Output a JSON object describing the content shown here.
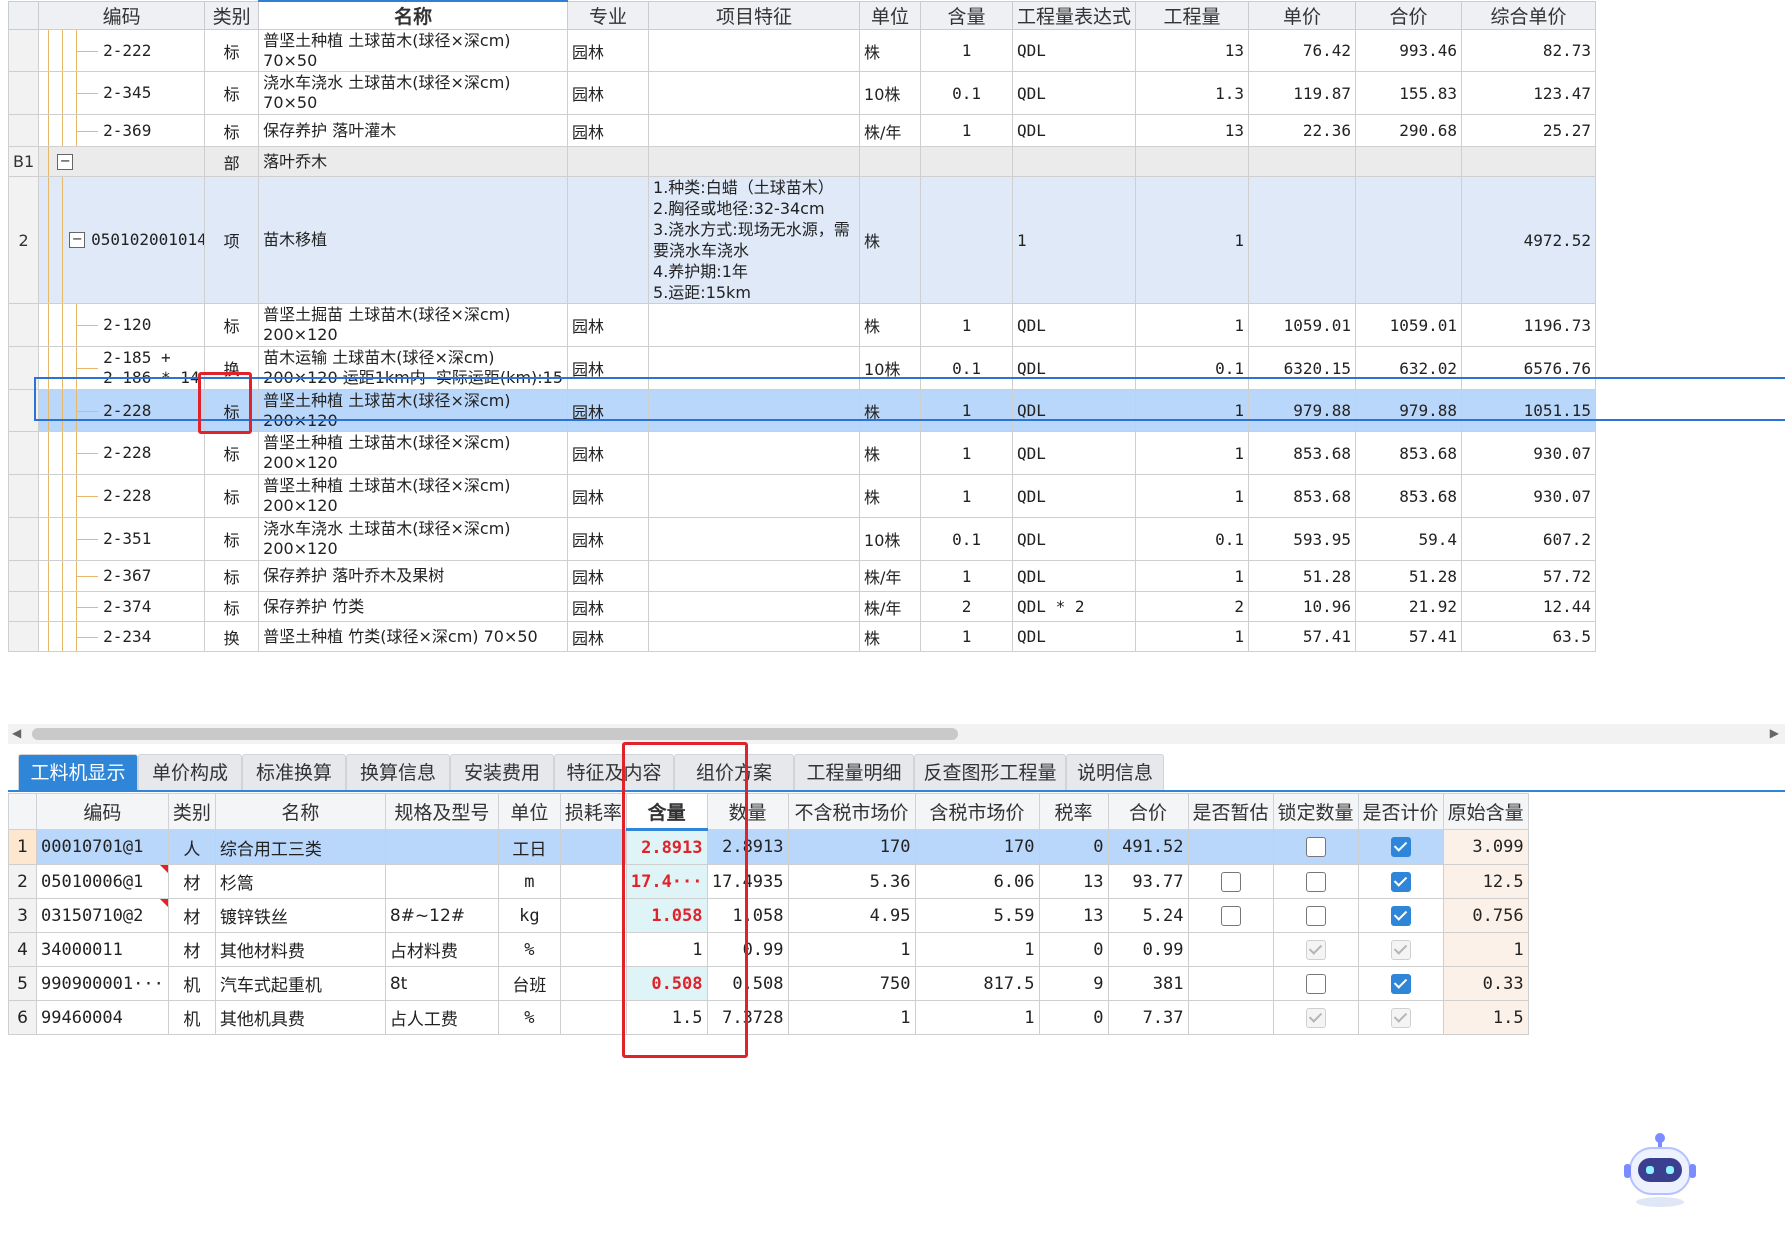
{
  "top_grid": {
    "headers": [
      "编码",
      "类别",
      "名称",
      "专业",
      "项目特征",
      "单位",
      "含量",
      "工程量表达式",
      "工程量",
      "单价",
      "合价",
      "综合单价"
    ],
    "rows": [
      {
        "rownum": "",
        "code": "2-222",
        "cat": "标",
        "name": "普坚土种植 土球苗木(球径×深cm)\n70×50",
        "major": "园林",
        "feature": "",
        "unit": "株",
        "content": "1",
        "expr": "QDL",
        "qty": "13",
        "price": "76.42",
        "total": "993.46",
        "comp": "82.73"
      },
      {
        "rownum": "",
        "code": "2-345",
        "cat": "标",
        "name": "浇水车浇水 土球苗木(球径×深cm)\n70×50",
        "major": "园林",
        "feature": "",
        "unit": "10株",
        "content": "0.1",
        "expr": "QDL",
        "qty": "1.3",
        "price": "119.87",
        "total": "155.83",
        "comp": "123.47"
      },
      {
        "rownum": "",
        "code": "2-369",
        "cat": "标",
        "name": "保存养护 落叶灌木",
        "major": "园林",
        "feature": "",
        "unit": "株/年",
        "content": "1",
        "expr": "QDL",
        "qty": "13",
        "price": "22.36",
        "total": "290.68",
        "comp": "25.27"
      },
      {
        "rownum": "B1",
        "code": "",
        "cat": "部",
        "name": "落叶乔木",
        "major": "",
        "feature": "",
        "unit": "",
        "content": "",
        "expr": "",
        "qty": "",
        "price": "",
        "total": "",
        "comp": ""
      },
      {
        "rownum": "2",
        "code": "050102001014",
        "cat": "项",
        "name": "苗木移植",
        "major": "",
        "feature": "1.种类:白蜡（土球苗木）\n2.胸径或地径:32-34cm\n3.浇水方式:现场无水源，需\n要浇水车浇水\n4.养护期:1年\n5.运距:15km",
        "unit": "株",
        "content": "",
        "expr": "1",
        "qty": "1",
        "price": "",
        "total": "",
        "comp": "4972.52"
      },
      {
        "rownum": "",
        "code": "2-120",
        "cat": "标",
        "name": "普坚土掘苗 土球苗木(球径×深cm)\n200×120",
        "major": "园林",
        "feature": "",
        "unit": "株",
        "content": "1",
        "expr": "QDL",
        "qty": "1",
        "price": "1059.01",
        "total": "1059.01",
        "comp": "1196.73"
      },
      {
        "rownum": "",
        "code": "2-185 +\n2-186 * 14",
        "cat": "换",
        "name": "苗木运输 土球苗木(球径×深cm)\n200×120 运距1km内  实际运距(km):15",
        "major": "园林",
        "feature": "",
        "unit": "10株",
        "content": "0.1",
        "expr": "QDL",
        "qty": "0.1",
        "price": "6320.15",
        "total": "632.02",
        "comp": "6576.76"
      },
      {
        "rownum": "",
        "code": "2-228",
        "cat": "标",
        "name": "普坚土种植 土球苗木(球径×深cm)\n200×120",
        "major": "园林",
        "feature": "",
        "unit": "株",
        "content": "1",
        "expr": "QDL",
        "qty": "1",
        "price": "979.88",
        "total": "979.88",
        "comp": "1051.15"
      },
      {
        "rownum": "",
        "code": "2-228",
        "cat": "标",
        "name": "普坚土种植 土球苗木(球径×深cm)\n200×120",
        "major": "园林",
        "feature": "",
        "unit": "株",
        "content": "1",
        "expr": "QDL",
        "qty": "1",
        "price": "853.68",
        "total": "853.68",
        "comp": "930.07"
      },
      {
        "rownum": "",
        "code": "2-228",
        "cat": "标",
        "name": "普坚土种植 土球苗木(球径×深cm)\n200×120",
        "major": "园林",
        "feature": "",
        "unit": "株",
        "content": "1",
        "expr": "QDL",
        "qty": "1",
        "price": "853.68",
        "total": "853.68",
        "comp": "930.07"
      },
      {
        "rownum": "",
        "code": "2-351",
        "cat": "标",
        "name": "浇水车浇水 土球苗木(球径×深cm)\n200×120",
        "major": "园林",
        "feature": "",
        "unit": "10株",
        "content": "0.1",
        "expr": "QDL",
        "qty": "0.1",
        "price": "593.95",
        "total": "59.4",
        "comp": "607.2"
      },
      {
        "rownum": "",
        "code": "2-367",
        "cat": "标",
        "name": "保存养护 落叶乔木及果树",
        "major": "园林",
        "feature": "",
        "unit": "株/年",
        "content": "1",
        "expr": "QDL",
        "qty": "1",
        "price": "51.28",
        "total": "51.28",
        "comp": "57.72"
      },
      {
        "rownum": "",
        "code": "2-374",
        "cat": "标",
        "name": "保存养护 竹类",
        "major": "园林",
        "feature": "",
        "unit": "株/年",
        "content": "2",
        "expr": "QDL * 2",
        "qty": "2",
        "price": "10.96",
        "total": "21.92",
        "comp": "12.44"
      },
      {
        "rownum": "",
        "code": "2-234",
        "cat": "换",
        "name": "普坚土种植 竹类(球径×深cm) 70×50",
        "major": "园林",
        "feature": "",
        "unit": "株",
        "content": "1",
        "expr": "QDL",
        "qty": "1",
        "price": "57.41",
        "total": "57.41",
        "comp": "63.5"
      }
    ]
  },
  "tabs": [
    "工料机显示",
    "单价构成",
    "标准换算",
    "换算信息",
    "安装费用",
    "特征及内容",
    "组价方案",
    "工程量明细",
    "反查图形工程量",
    "说明信息"
  ],
  "bottom_grid": {
    "headers": [
      "编码",
      "类别",
      "名称",
      "规格及型号",
      "单位",
      "损耗率",
      "含量",
      "数量",
      "不含税市场价",
      "含税市场价",
      "税率",
      "合价",
      "是否暂估",
      "锁定数量",
      "是否计价",
      "原始含量"
    ],
    "rows": [
      {
        "n": "1",
        "code": "00010701@1",
        "cat": "人",
        "name": "综合用工三类",
        "spec": "",
        "unit": "工日",
        "loss": "",
        "content": "2.8913",
        "qty": "2.8913",
        "price_ex": "170",
        "price_in": "170",
        "tax": "0",
        "total": "491.52",
        "est": "",
        "lock": "off",
        "priced": "on",
        "orig": "3.099"
      },
      {
        "n": "2",
        "code": "05010006@1",
        "cat": "材",
        "name": "杉篙",
        "spec": "",
        "unit": "m",
        "loss": "",
        "content": "17.4···",
        "qty": "17.4935",
        "price_ex": "5.36",
        "price_in": "6.06",
        "tax": "13",
        "total": "93.77",
        "est": "off",
        "lock": "off",
        "priced": "on",
        "orig": "12.5"
      },
      {
        "n": "3",
        "code": "03150710@2",
        "cat": "材",
        "name": "镀锌铁丝",
        "spec": "8#~12#",
        "unit": "kg",
        "loss": "",
        "content": "1.058",
        "qty": "1.058",
        "price_ex": "4.95",
        "price_in": "5.59",
        "tax": "13",
        "total": "5.24",
        "est": "off",
        "lock": "off",
        "priced": "on",
        "orig": "0.756"
      },
      {
        "n": "4",
        "code": "34000011",
        "cat": "材",
        "name": "其他材料费",
        "spec": "占材料费",
        "unit": "%",
        "loss": "",
        "content": "1",
        "qty": "0.99",
        "price_ex": "1",
        "price_in": "1",
        "tax": "0",
        "total": "0.99",
        "est": "",
        "lock": "dis",
        "priced": "dis",
        "orig": "1"
      },
      {
        "n": "5",
        "code": "990900001···",
        "cat": "机",
        "name": "汽车式起重机",
        "spec": "8t",
        "unit": "台班",
        "loss": "",
        "content": "0.508",
        "qty": "0.508",
        "price_ex": "750",
        "price_in": "817.5",
        "tax": "9",
        "total": "381",
        "est": "",
        "lock": "off",
        "priced": "on",
        "orig": "0.33"
      },
      {
        "n": "6",
        "code": "99460004",
        "cat": "机",
        "name": "其他机具费",
        "spec": "占人工费",
        "unit": "%",
        "loss": "",
        "content": "1.5",
        "qty": "7.3728",
        "price_ex": "1",
        "price_in": "1",
        "tax": "0",
        "total": "7.37",
        "est": "",
        "lock": "dis",
        "priced": "dis",
        "orig": "1.5"
      }
    ]
  },
  "colors": {
    "accent": "#2f86d8",
    "highlight_red": "#e0222a",
    "tree_line": "#e6b86a"
  },
  "icons": {
    "assistant": "robot-assistant-icon"
  }
}
